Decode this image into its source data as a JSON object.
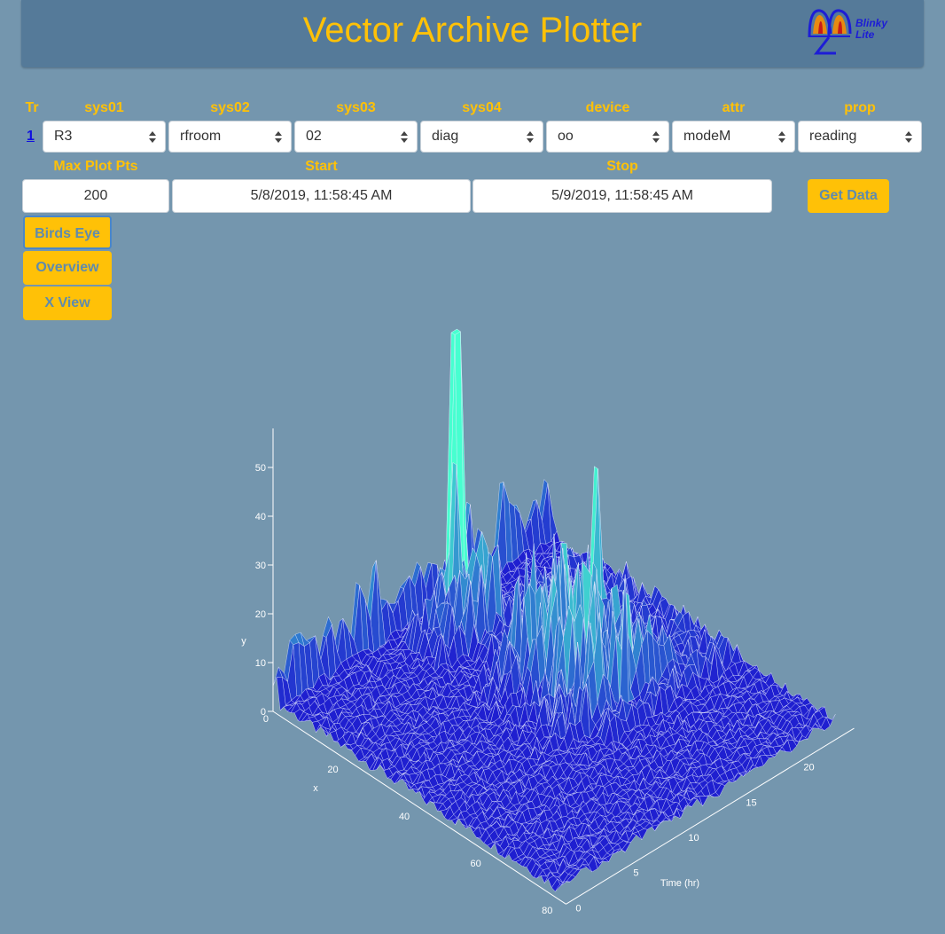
{
  "header": {
    "title": "Vector Archive Plotter",
    "logo_line1": "Blinky",
    "logo_line2": "Lite"
  },
  "columns": [
    "Tr",
    "sys01",
    "sys02",
    "sys03",
    "sys04",
    "device",
    "attr",
    "prop"
  ],
  "row": {
    "tr_link": "1",
    "sys01": "R3",
    "sys02": "rfroom",
    "sys03": "02",
    "sys04": "diag",
    "device": "oo",
    "attr": "modeM",
    "prop": "reading"
  },
  "range": {
    "max_plot_pts_label": "Max Plot Pts",
    "max_plot_pts": "200",
    "start_label": "Start",
    "start": "5/8/2019, 11:58:45 AM",
    "stop_label": "Stop",
    "stop": "5/9/2019, 11:58:45 AM",
    "get_data": "Get Data"
  },
  "views": [
    "Birds Eye",
    "Overview",
    "X View"
  ],
  "colors": {
    "accent": "#ffc107",
    "background": "#7496ae",
    "header": "#557a99",
    "surface_low": "#1f1fd0",
    "surface_high": "#40ffd0"
  },
  "chart_data": {
    "type": "surface",
    "y_axis": {
      "label": "y",
      "ticks": [
        0,
        10,
        20,
        30,
        40,
        50
      ]
    },
    "x_axis": {
      "label": "x",
      "ticks": [
        0,
        20,
        40,
        60,
        80
      ]
    },
    "t_axis": {
      "label": "Time (hr)",
      "ticks": [
        0,
        5,
        10,
        15,
        20
      ]
    },
    "peak_value": 55
  }
}
